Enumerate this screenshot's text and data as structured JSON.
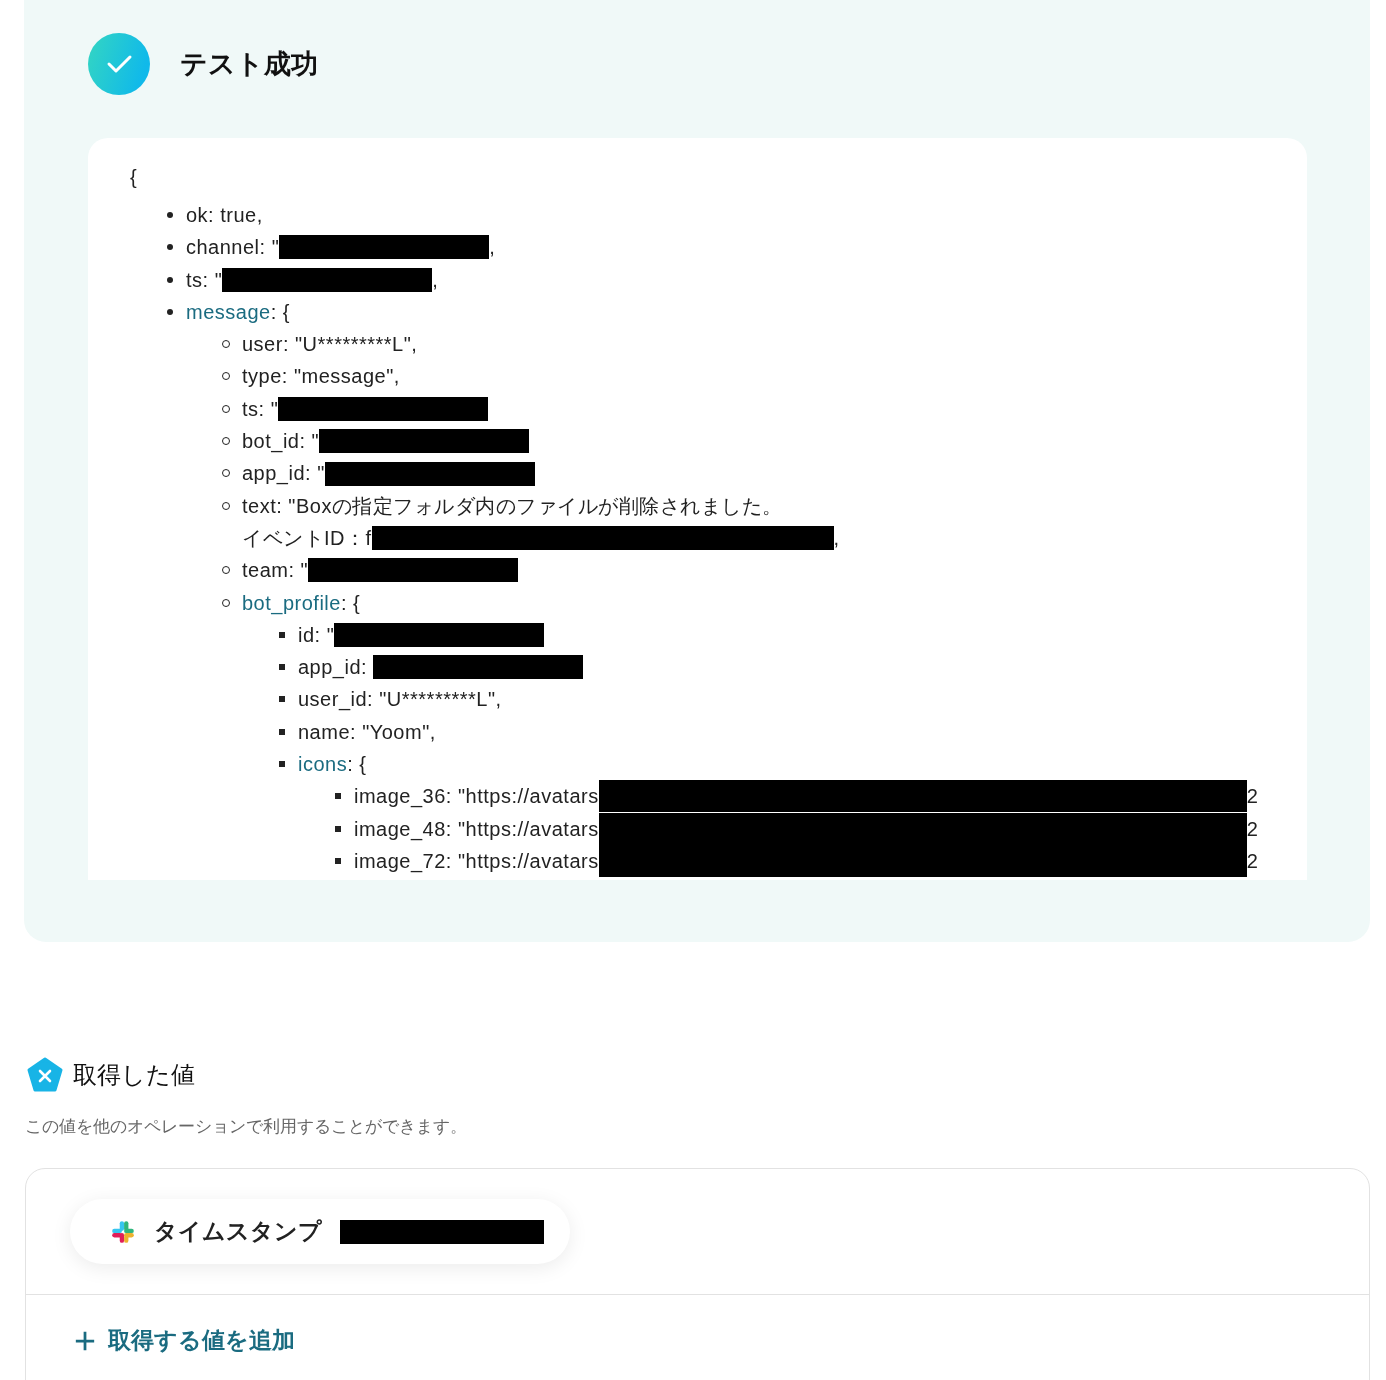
{
  "result": {
    "title": "テスト成功",
    "open_brace": "{",
    "lines": [
      {
        "kind": "value",
        "key": "ok:",
        "value": "true,"
      },
      {
        "kind": "value",
        "key": "channel:",
        "value": "\"",
        "redacted": true,
        "suffix": ","
      },
      {
        "kind": "value",
        "key": "ts:",
        "value": "\"",
        "redacted": true,
        "suffix": ","
      },
      {
        "kind": "object",
        "key": "message",
        "value": ": {",
        "children": [
          {
            "kind": "value",
            "key": "user:",
            "value": "\"U*********L\","
          },
          {
            "kind": "value",
            "key": "type:",
            "value": "\"message\","
          },
          {
            "kind": "value",
            "key": "ts:",
            "value": "\"",
            "redacted": true
          },
          {
            "kind": "value",
            "key": "bot_id:",
            "value": "\"",
            "redacted": true
          },
          {
            "kind": "value",
            "key": "app_id:",
            "value": "\"",
            "redacted": true
          },
          {
            "kind": "value",
            "key": "text:",
            "value": "\"Boxの指定フォルダ内のファイルが削除されました。",
            "continuation": "イベントID：f",
            "redacted": true,
            "suffix": ","
          },
          {
            "kind": "value",
            "key": "team:",
            "value": "\"",
            "redacted": true
          },
          {
            "kind": "object",
            "key": "bot_profile",
            "value": ": {",
            "children": [
              {
                "kind": "value",
                "key": "id:",
                "value": "\"",
                "redacted": true
              },
              {
                "kind": "value",
                "key": "app_id:",
                "redacted": true
              },
              {
                "kind": "value",
                "key": "user_id:",
                "value": "\"U*********L\","
              },
              {
                "kind": "value",
                "key": "name:",
                "value": "\"Yoom\","
              },
              {
                "kind": "object",
                "key": "icons",
                "value": ": {",
                "children": [
                  {
                    "kind": "value",
                    "key": "image_36:",
                    "value": "\"https://avatars",
                    "redacted": true,
                    "suffix": "2"
                  },
                  {
                    "kind": "value",
                    "key": "image_48:",
                    "value": "\"https://avatars",
                    "redacted": true,
                    "suffix": "2"
                  },
                  {
                    "kind": "value",
                    "key": "image_72:",
                    "value": "\"https://avatars",
                    "redacted": true,
                    "suffix": "2"
                  }
                ]
              }
            ]
          }
        ]
      }
    ]
  },
  "obtained": {
    "title": "取得した値",
    "description": "この値を他のオペレーションで利用することができます。",
    "values": [
      {
        "label": "タイムスタンプ",
        "redacted": true
      }
    ],
    "add_button": "取得する値を追加"
  }
}
